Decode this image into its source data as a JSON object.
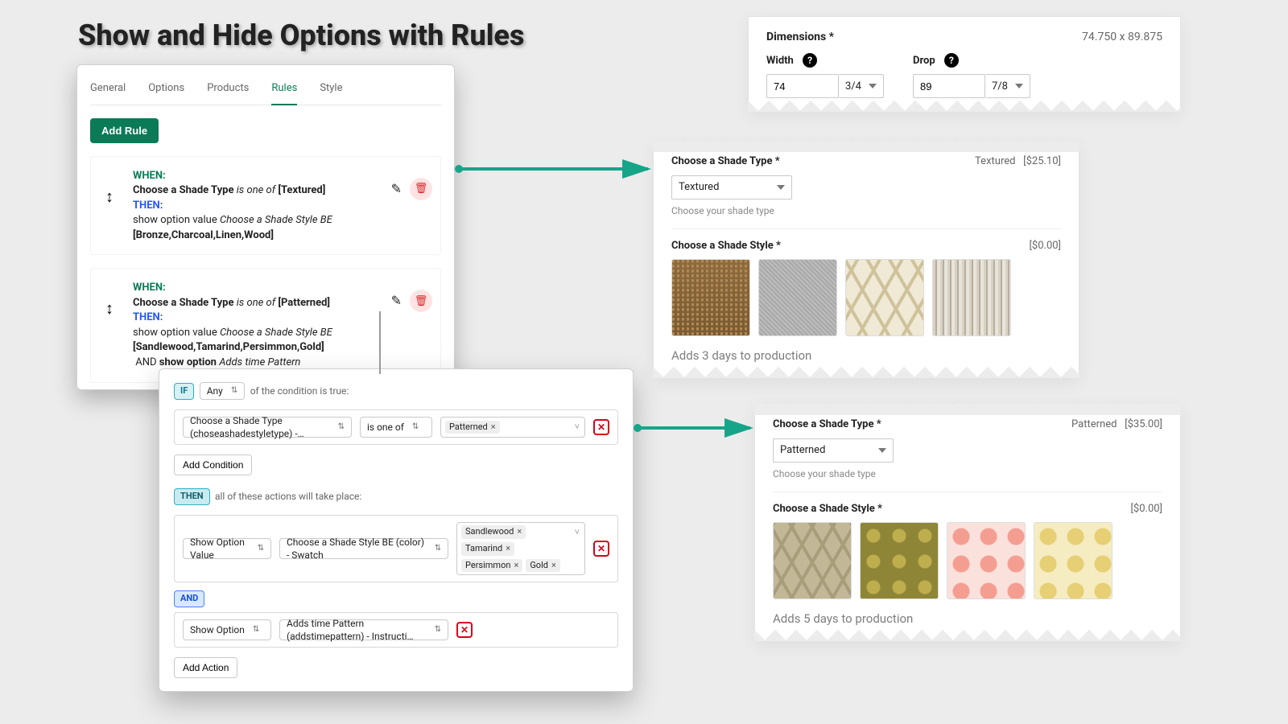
{
  "title": "Show and Hide Options with Rules",
  "rules_panel": {
    "tabs": [
      "General",
      "Options",
      "Products",
      "Rules",
      "Style"
    ],
    "add_rule": "Add Rule",
    "rules": [
      {
        "when_label": "WHEN:",
        "when_subject": "Choose a Shade Type",
        "when_op": "is one of",
        "when_value": "[Textured]",
        "then_label": "THEN:",
        "then_action": "show option value",
        "then_target": "Choose a Shade Style BE",
        "then_values": "[Bronze,Charcoal,Linen,Wood]"
      },
      {
        "when_label": "WHEN:",
        "when_subject": "Choose a Shade Type",
        "when_op": "is one of",
        "when_value": "[Patterned]",
        "then_label": "THEN:",
        "then_action": "show option value",
        "then_target": "Choose a Shade Style BE",
        "then_values": "[Sandlewood,Tamarind,Persimmon,Gold]",
        "and_label": "AND",
        "and_action": "show option",
        "and_target": "Adds time Pattern"
      }
    ]
  },
  "editor": {
    "if_label": "IF",
    "if_mode": "Any",
    "if_suffix": "of the condition is true:",
    "condition": {
      "field": "Choose a Shade Type (choseashadestyletype) -…",
      "op": "is one of",
      "values": [
        "Patterned"
      ]
    },
    "add_condition": "Add Condition",
    "then_label": "THEN",
    "then_suffix": "all of these actions will take place:",
    "action1": {
      "type": "Show Option Value",
      "target": "Choose a Shade Style BE (color) - Swatch",
      "values": [
        "Sandlewood",
        "Tamarind",
        "Persimmon",
        "Gold"
      ]
    },
    "and_label": "AND",
    "action2": {
      "type": "Show Option",
      "target": "Adds time Pattern (addstimepattern) - Instructi…"
    },
    "add_action": "Add Action"
  },
  "preview": {
    "dimensions": {
      "title": "Dimensions *",
      "size": "74.750 x 89.875",
      "width_label": "Width",
      "width": "74",
      "width_frac": "3/4",
      "drop_label": "Drop",
      "drop": "89",
      "drop_frac": "7/8"
    },
    "textured": {
      "shade_type_title": "Choose a Shade Type *",
      "selected": "Textured",
      "price": "[$25.10]",
      "desc": "Choose your shade type",
      "style_title": "Choose a Shade Style *",
      "style_price": "[$0.00]",
      "production": "Adds 3 days to production"
    },
    "patterned": {
      "shade_type_title": "Choose a Shade Type *",
      "selected": "Patterned",
      "price": "[$35.00]",
      "desc": "Choose your shade type",
      "style_title": "Choose a Shade Style *",
      "style_price": "[$0.00]",
      "production": "Adds 5 days to production"
    }
  }
}
